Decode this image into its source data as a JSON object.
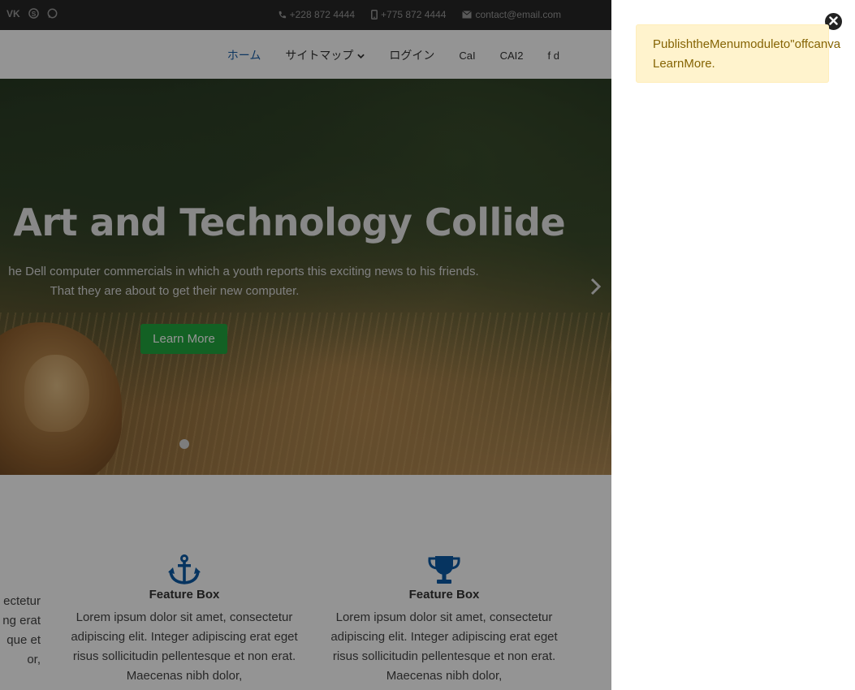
{
  "topbar": {
    "social": [
      {
        "icon": "vk-icon",
        "glyph": "VK"
      },
      {
        "icon": "skype-icon",
        "glyph": "S"
      },
      {
        "icon": "whatsapp-icon",
        "glyph": "W"
      }
    ],
    "phone": "+228 872 4444",
    "mobile": "+775 872 4444",
    "email": "contact@email.com"
  },
  "nav": {
    "items": [
      "ホーム",
      "サイトマップ",
      "ログイン",
      "CaI",
      "CAI2",
      "f d"
    ]
  },
  "hero": {
    "title": "e Art and Technology Collide",
    "subtitle_line1": "he Dell computer commercials in which a youth reports this exciting news to his friends.",
    "subtitle_line2": "That they are about to get their new computer.",
    "button": "Learn More"
  },
  "features": [
    {
      "title": "",
      "text": "ectetur\nng erat\nque et\nor,",
      "icon": "none"
    },
    {
      "title": "Feature Box",
      "text": "Lorem ipsum dolor sit amet, consectetur adipiscing elit. Integer adipiscing erat eget risus sollicitudin pellentesque et non erat. Maecenas nibh dolor,",
      "icon": "anchor-icon"
    },
    {
      "title": "Feature Box",
      "text": "Lorem ipsum dolor sit amet, consectetur adipiscing elit. Integer adipiscing erat eget risus sollicitudin pellentesque et non erat. Maecenas nibh dolor,",
      "icon": "trophy-icon"
    }
  ],
  "offcanvas": {
    "alert_line1": "PublishtheMenumoduleto\"offcanva",
    "alert_line2": "LearnMore."
  },
  "colors": {
    "accent_blue": "#1b5fa8",
    "button_green": "#22a83f",
    "alert_bg": "#fff3cd",
    "alert_text": "#856404"
  }
}
